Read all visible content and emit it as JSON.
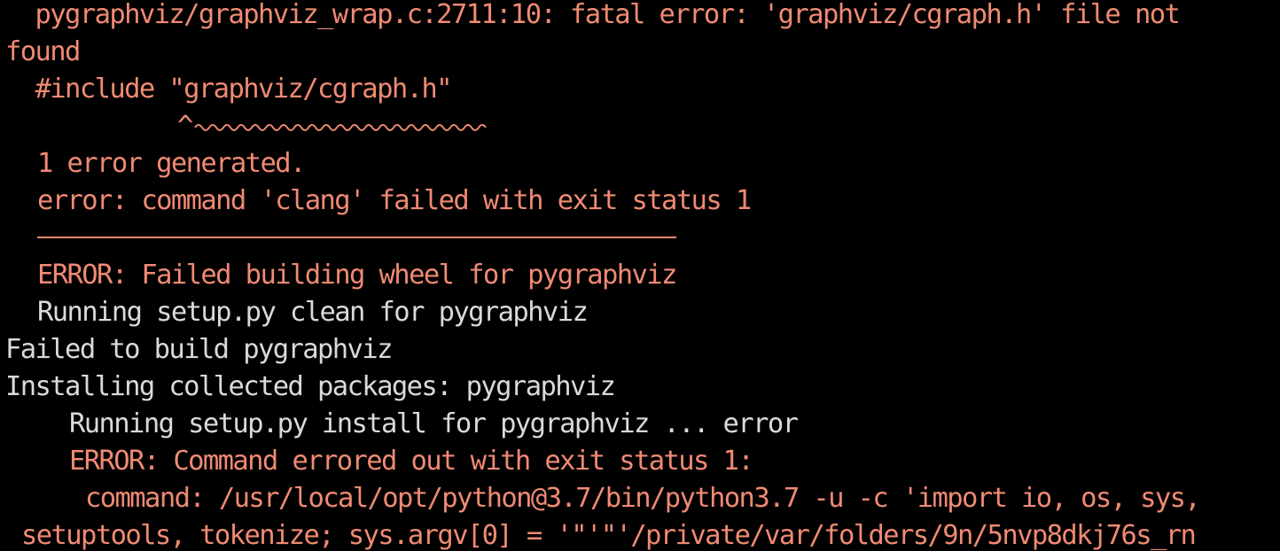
{
  "terminal": {
    "lines": [
      "  pygraphviz/graphviz_wrap.c:2711:10: fatal error: 'graphviz/cgraph.h' file not",
      "found",
      "  #include \"graphviz/cgraph.h\"",
      "1 error generated.",
      "error: command 'clang' failed with exit status 1",
      "ERROR: Failed building wheel for pygraphviz",
      "Running setup.py clean for pygraphviz",
      "Failed to build pygraphviz",
      "Installing collected packages: pygraphviz",
      "Running setup.py install for pygraphviz ... error",
      "ERROR: Command errored out with exit status 1:",
      "command: /usr/local/opt/python@3.7/bin/python3.7 -u -c 'import io, os, sys,",
      "setuptools, tokenize; sys.argv[0] = '\"'\"'/private/var/folders/9n/5nvp8dkj76s_rn"
    ],
    "caret": "^",
    "colors": {
      "background": "#000000",
      "error_text": "#f08a73",
      "normal_text": "#dadada"
    }
  }
}
